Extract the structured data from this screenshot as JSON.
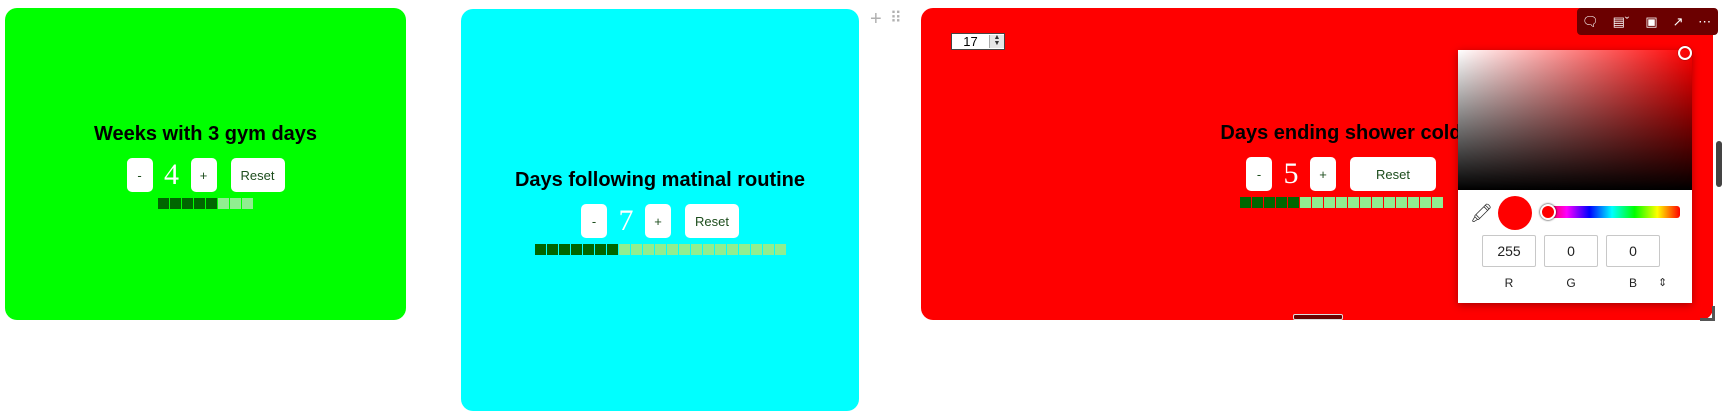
{
  "cards": [
    {
      "title": "Weeks with 3 gym days",
      "count": "4",
      "minus_label": "-",
      "plus_label": "+",
      "reset_label": "Reset",
      "progress_on": 5,
      "progress_total": 8,
      "background": "#00ff00"
    },
    {
      "title": "Days following matinal routine",
      "count": "7",
      "minus_label": "-",
      "plus_label": "+",
      "reset_label": "Reset",
      "progress_on": 7,
      "progress_total": 21,
      "background": "#00ffff"
    },
    {
      "title": "Days ending shower cold",
      "count": "5",
      "minus_label": "-",
      "plus_label": "+",
      "reset_label": "Reset",
      "progress_on": 5,
      "progress_total": 17,
      "background": "#ff0000"
    }
  ],
  "goal_input": {
    "value": "17"
  },
  "color_picker": {
    "r": "255",
    "g": "0",
    "b": "0",
    "r_label": "R",
    "g_label": "G",
    "b_label": "B",
    "format_toggle": "⇕",
    "selected_color": "#ff0000",
    "eyedropper_icon": "eyedropper-icon"
  },
  "toolbar": {
    "icons": [
      "comment-icon",
      "align-icon",
      "chevron-down-icon",
      "layout-icon",
      "open-external-icon",
      "more-icon"
    ]
  },
  "block_handles": {
    "add": "+",
    "drag": "⠿"
  },
  "colors": {
    "progress_on": "#006600",
    "progress_off": "#90ee90",
    "button_text": "#1d4d1d",
    "toolbar_bg": "#6b0000"
  }
}
